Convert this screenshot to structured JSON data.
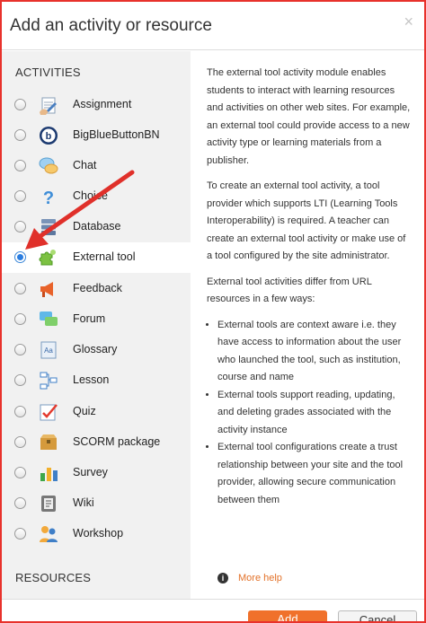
{
  "dialog": {
    "title": "Add an activity or resource",
    "close_glyph": "×"
  },
  "sections": {
    "activities": "ACTIVITIES",
    "resources": "RESOURCES"
  },
  "activities": [
    {
      "label": "Assignment",
      "icon": "assignment-icon"
    },
    {
      "label": "BigBlueButtonBN",
      "icon": "bigbluebutton-icon"
    },
    {
      "label": "Chat",
      "icon": "chat-icon"
    },
    {
      "label": "Choice",
      "icon": "choice-icon"
    },
    {
      "label": "Database",
      "icon": "database-icon"
    },
    {
      "label": "External tool",
      "icon": "external-tool-icon",
      "selected": true
    },
    {
      "label": "Feedback",
      "icon": "feedback-icon"
    },
    {
      "label": "Forum",
      "icon": "forum-icon"
    },
    {
      "label": "Glossary",
      "icon": "glossary-icon"
    },
    {
      "label": "Lesson",
      "icon": "lesson-icon"
    },
    {
      "label": "Quiz",
      "icon": "quiz-icon"
    },
    {
      "label": "SCORM package",
      "icon": "scorm-icon"
    },
    {
      "label": "Survey",
      "icon": "survey-icon"
    },
    {
      "label": "Wiki",
      "icon": "wiki-icon"
    },
    {
      "label": "Workshop",
      "icon": "workshop-icon"
    }
  ],
  "description": {
    "p1": "The external tool activity module enables students to interact with learning resources and activities on other web sites. For example, an external tool could provide access to a new activity type or learning materials from a publisher.",
    "p2": "To create an external tool activity, a tool provider which supports LTI (Learning Tools Interoperability) is required. A teacher can create an external tool activity or make use of a tool configured by the site administrator.",
    "p3": "External tool activities differ from URL resources in a few ways:",
    "bullets": [
      "External tools are context aware i.e. they have access to information about the user who launched the tool, such as institution, course and name",
      "External tools support reading, updating, and deleting grades associated with the activity instance",
      "External tool configurations create a trust relationship between your site and the tool provider, allowing secure communication between them"
    ],
    "more_help": "More help"
  },
  "footer": {
    "add_label": "Add",
    "cancel_label": "Cancel"
  },
  "colors": {
    "frame_border": "#e8322c",
    "accent": "#f0712b",
    "arrow": "#e0302a",
    "radio_selected": "#2a7de0"
  }
}
